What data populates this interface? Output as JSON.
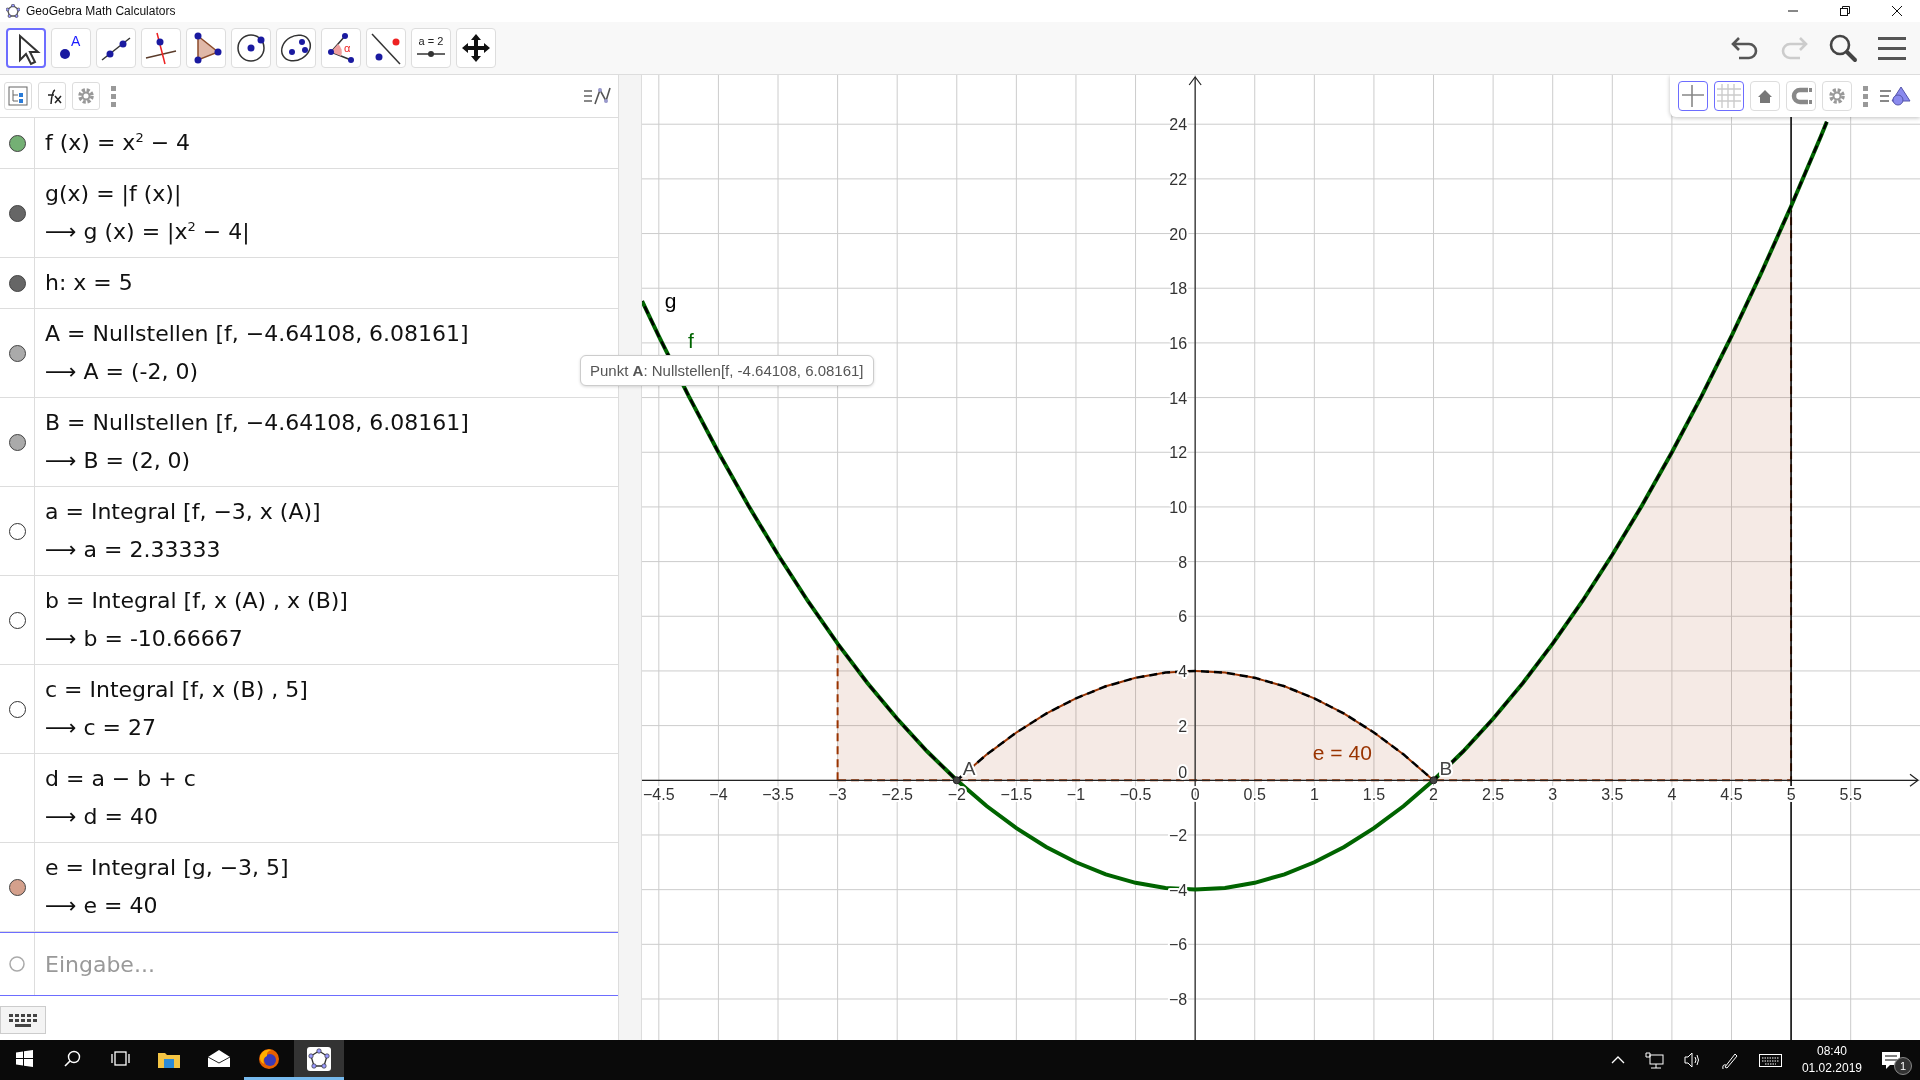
{
  "window": {
    "title": "GeoGebra Math Calculators"
  },
  "toolbar": {
    "tools": [
      {
        "kind": "move",
        "selected": true
      },
      {
        "kind": "point",
        "text": "A",
        "selected": false
      },
      {
        "kind": "line",
        "selected": false
      },
      {
        "kind": "perpendicular",
        "selected": false
      },
      {
        "kind": "polygon",
        "selected": false
      },
      {
        "kind": "circle",
        "selected": false
      },
      {
        "kind": "conic",
        "selected": false
      },
      {
        "kind": "angle",
        "text": "α",
        "selected": false
      },
      {
        "kind": "reflect",
        "selected": false
      },
      {
        "kind": "slider",
        "text": "a = 2",
        "selected": false
      },
      {
        "kind": "move-view",
        "selected": false
      }
    ],
    "actions": [
      {
        "kind": "undo",
        "disabled": false
      },
      {
        "kind": "redo",
        "disabled": true
      }
    ]
  },
  "algebra": {
    "items": [
      {
        "lines": [
          "f (x) = x$^{2}$ − 4"
        ],
        "visible": true,
        "color": "#74b074"
      },
      {
        "lines": [
          "g(x) = |f (x)|",
          "⟶ g (x) = |x$^{2}$ − 4|"
        ],
        "visible": true,
        "color": "#666666"
      },
      {
        "lines": [
          "h: x = 5"
        ],
        "visible": true,
        "color": "#666666"
      },
      {
        "lines": [
          "A = Nullstellen [f, −4.64108, 6.08161]",
          "⟶ A = (-2, 0)"
        ],
        "visible": true,
        "color": "#aaaaaa"
      },
      {
        "lines": [
          "B = Nullstellen [f, −4.64108, 6.08161]",
          "⟶ B = (2, 0)"
        ],
        "visible": true,
        "color": "#aaaaaa"
      },
      {
        "lines": [
          "a = Integral [f, −3, x (A)]",
          "⟶ a = 2.33333"
        ],
        "visible": false
      },
      {
        "lines": [
          "b = Integral [f, x (A) , x (B)]",
          "⟶ b = -10.66667"
        ],
        "visible": false
      },
      {
        "lines": [
          "c = Integral [f, x (B) , 5]",
          "⟶ c = 27"
        ],
        "visible": false
      },
      {
        "lines": [
          "d = a − b + c",
          "⟶ d = 40"
        ]
      },
      {
        "lines": [
          "e = Integral [g, −3, 5]",
          "⟶ e = 40"
        ],
        "visible": true,
        "color": "#d4a08c"
      }
    ],
    "input": {
      "placeholder": "Eingabe..."
    }
  },
  "tooltip": "Punkt **A**: Nullstellen[f, -4.64108, 6.08161]",
  "graphics": {
    "style_bar": [
      {
        "kind": "axes",
        "selected": true
      },
      {
        "kind": "grid",
        "selected": true
      },
      {
        "kind": "home",
        "selected": false
      },
      {
        "kind": "snap",
        "selected": false
      },
      {
        "kind": "settings",
        "selected": false
      }
    ],
    "chart_data": {
      "type": "line",
      "grid": true,
      "x": [
        -4.64,
        -4.5,
        -4.25,
        -4,
        -3.75,
        -3.5,
        -3.25,
        -3,
        -2.75,
        -2.5,
        -2.25,
        -2,
        -1.75,
        -1.5,
        -1.25,
        -1,
        -0.75,
        -0.5,
        -0.25,
        0,
        0.25,
        0.5,
        0.75,
        1,
        1.25,
        1.5,
        1.75,
        2,
        2.25,
        2.5,
        2.75,
        3,
        3.25,
        3.5,
        3.75,
        4,
        4.25,
        4.5,
        4.75,
        5,
        5.25,
        5.3
      ],
      "series": [
        {
          "name": "f",
          "color": "#006400",
          "line_style": "solid",
          "values": [
            17.53,
            16.25,
            14.06,
            12,
            10.06,
            8.25,
            6.56,
            5,
            3.56,
            2.25,
            1.06,
            0,
            -0.94,
            -1.75,
            -2.44,
            -3,
            -3.44,
            -3.75,
            -3.94,
            -4,
            -3.94,
            -3.75,
            -3.44,
            -3,
            -2.44,
            -1.75,
            -0.94,
            0,
            1.06,
            2.25,
            3.56,
            5,
            6.56,
            8.25,
            10.06,
            12,
            14.06,
            16.25,
            18.56,
            21,
            23.56,
            24.09
          ]
        },
        {
          "name": "g",
          "color": "#000000",
          "line_style": "dashed",
          "values": [
            17.53,
            16.25,
            14.06,
            12,
            10.06,
            8.25,
            6.56,
            5,
            3.56,
            2.25,
            1.06,
            0,
            0.94,
            1.75,
            2.44,
            3,
            3.44,
            3.75,
            3.94,
            4,
            3.94,
            3.75,
            3.44,
            3,
            2.44,
            1.75,
            0.94,
            0,
            1.06,
            2.25,
            3.56,
            5,
            6.56,
            8.25,
            10.06,
            12,
            14.06,
            16.25,
            18.56,
            21,
            23.56,
            24.09
          ]
        },
        {
          "name": "e = 40",
          "type": "area",
          "color": "#993300",
          "line_style": "dashed",
          "values": [
            null,
            null,
            null,
            null,
            null,
            null,
            null,
            5,
            3.56,
            2.25,
            1.06,
            0,
            0.94,
            1.75,
            2.44,
            3,
            3.44,
            3.75,
            3.94,
            4,
            3.94,
            3.75,
            3.44,
            3,
            2.44,
            1.75,
            0.94,
            0,
            1.06,
            2.25,
            3.56,
            5,
            6.56,
            8.25,
            10.06,
            12,
            14.06,
            16.25,
            18.56,
            21,
            null,
            null
          ]
        }
      ],
      "xlim": [
        -4.64108,
        6.08161
      ],
      "ylim": [
        -9.5,
        25.8
      ],
      "xticks": [
        {
          "value": -4.5,
          "label": "−4.5"
        },
        {
          "value": -4,
          "label": "−4"
        },
        {
          "value": -3.5,
          "label": "−3.5"
        },
        {
          "value": -3,
          "label": "−3"
        },
        {
          "value": -2.5,
          "label": "−2.5"
        },
        {
          "value": -2,
          "label": "−2"
        },
        {
          "value": -1.5,
          "label": "−1.5"
        },
        {
          "value": -1,
          "label": "−1"
        },
        {
          "value": -0.5,
          "label": "−0.5"
        },
        0,
        0.5,
        1,
        1.5,
        2,
        2.5,
        3,
        3.5,
        4,
        4.5,
        5,
        5.5
      ],
      "yticks": [
        {
          "value": -8,
          "label": "−8"
        },
        {
          "value": -6,
          "label": "−6"
        },
        {
          "value": -4,
          "label": "−4"
        },
        {
          "value": -2,
          "label": "−2"
        },
        0,
        2,
        4,
        6,
        8,
        10,
        12,
        14,
        16,
        18,
        20,
        22,
        24
      ],
      "ref_lines": [
        {
          "axis": "x",
          "value": 5,
          "color": "#000000"
        }
      ],
      "annotations": [
        {
          "text": "A",
          "x": -2,
          "y": 0
        },
        {
          "text": "B",
          "x": 2,
          "y": 0
        }
      ]
    }
  },
  "taskbar": {
    "buttons": [
      {
        "kind": "start"
      },
      {
        "kind": "search"
      },
      {
        "kind": "task-view"
      }
    ],
    "apps": [
      {
        "kind": "explorer",
        "running": false,
        "selected": false
      },
      {
        "kind": "mail",
        "running": false,
        "selected": false
      },
      {
        "kind": "firefox",
        "running": true,
        "selected": false
      },
      {
        "kind": "geogebra",
        "running": true,
        "selected": true
      }
    ],
    "time": "08:40",
    "date": "01.02.2019",
    "notifications": "1"
  }
}
